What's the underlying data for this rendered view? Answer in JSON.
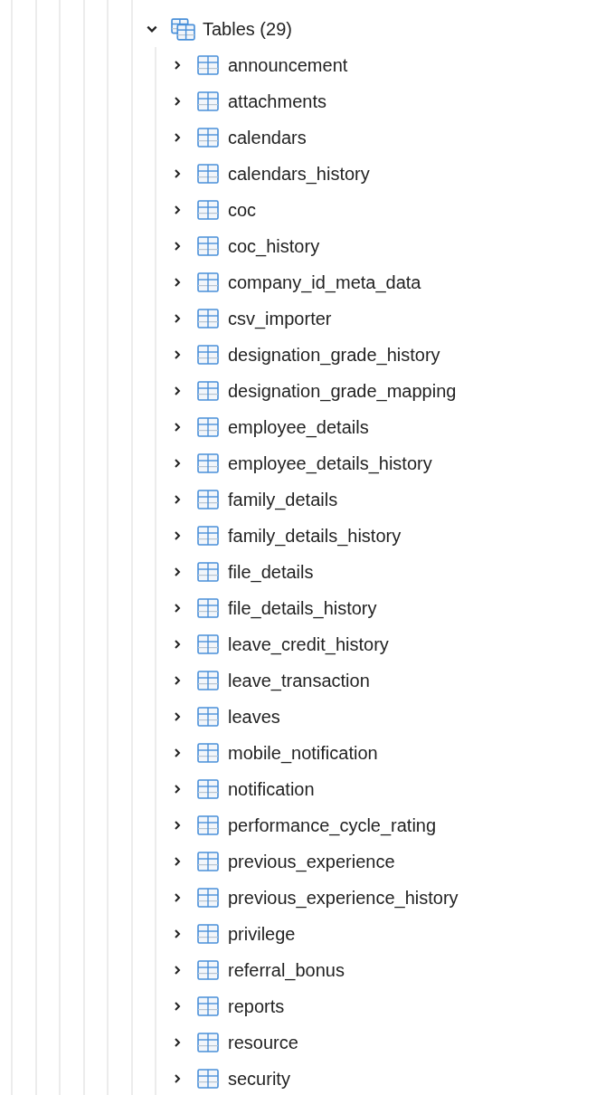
{
  "tree": [
    {
      "label": "Tables (29)",
      "kind": "group",
      "expanded": true,
      "children": [
        {
          "label": "announcement",
          "kind": "table",
          "expanded": false
        },
        {
          "label": "attachments",
          "kind": "table",
          "expanded": false
        },
        {
          "label": "calendars",
          "kind": "table",
          "expanded": false
        },
        {
          "label": "calendars_history",
          "kind": "table",
          "expanded": false
        },
        {
          "label": "coc",
          "kind": "table",
          "expanded": false
        },
        {
          "label": "coc_history",
          "kind": "table",
          "expanded": false
        },
        {
          "label": "company_id_meta_data",
          "kind": "table",
          "expanded": false
        },
        {
          "label": "csv_importer",
          "kind": "table",
          "expanded": false
        },
        {
          "label": "designation_grade_history",
          "kind": "table",
          "expanded": false
        },
        {
          "label": "designation_grade_mapping",
          "kind": "table",
          "expanded": false
        },
        {
          "label": "employee_details",
          "kind": "table",
          "expanded": false
        },
        {
          "label": "employee_details_history",
          "kind": "table",
          "expanded": false
        },
        {
          "label": "family_details",
          "kind": "table",
          "expanded": false
        },
        {
          "label": "family_details_history",
          "kind": "table",
          "expanded": false
        },
        {
          "label": "file_details",
          "kind": "table",
          "expanded": false
        },
        {
          "label": "file_details_history",
          "kind": "table",
          "expanded": false
        },
        {
          "label": "leave_credit_history",
          "kind": "table",
          "expanded": false
        },
        {
          "label": "leave_transaction",
          "kind": "table",
          "expanded": false
        },
        {
          "label": "leaves",
          "kind": "table",
          "expanded": false
        },
        {
          "label": "mobile_notification",
          "kind": "table",
          "expanded": false
        },
        {
          "label": "notification",
          "kind": "table",
          "expanded": false
        },
        {
          "label": "performance_cycle_rating",
          "kind": "table",
          "expanded": false
        },
        {
          "label": "previous_experience",
          "kind": "table",
          "expanded": false
        },
        {
          "label": "previous_experience_history",
          "kind": "table",
          "expanded": false
        },
        {
          "label": "privilege",
          "kind": "table",
          "expanded": false
        },
        {
          "label": "referral_bonus",
          "kind": "table",
          "expanded": false
        },
        {
          "label": "reports",
          "kind": "table",
          "expanded": false
        },
        {
          "label": "resource",
          "kind": "table",
          "expanded": false
        },
        {
          "label": "security",
          "kind": "table",
          "expanded": false
        }
      ]
    }
  ]
}
